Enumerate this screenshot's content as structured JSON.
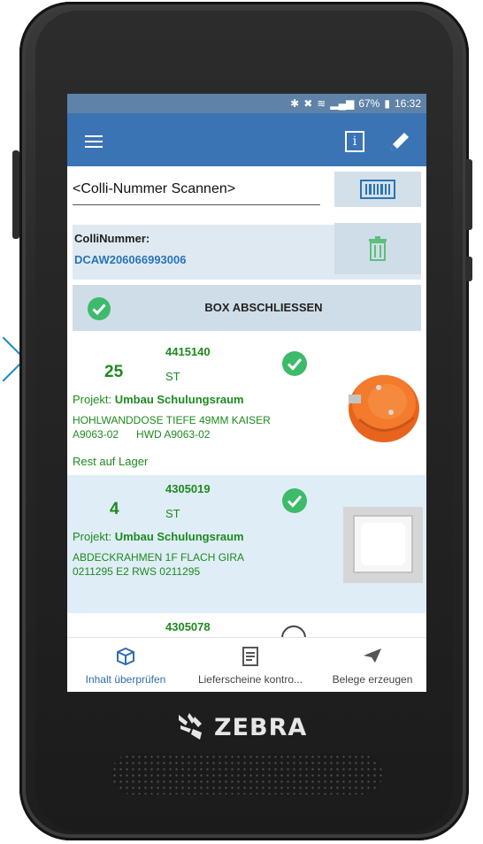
{
  "status_bar": {
    "icons": [
      "bluetooth-icon",
      "nfc-icon",
      "wifi-icon",
      "signal-icon",
      "battery-icon"
    ],
    "battery": "67%",
    "time": "16:32"
  },
  "app_bar": {
    "menu_icon": "hamburger-menu-icon",
    "info_icon": "info-icon",
    "edit_icon": "pencil-icon",
    "color": "#3a74b4"
  },
  "scan": {
    "placeholder": "<Colli-Nummer Scannen>",
    "button_icon": "barcode-icon"
  },
  "colli": {
    "label": "ColliNummer:",
    "value": "DCAW206066993006",
    "delete_icon": "trash-icon"
  },
  "box_close": {
    "label": "BOX ABSCHLIESSEN",
    "icon": "check-circle-icon"
  },
  "items": [
    {
      "article_no": "4415140",
      "quantity": "25",
      "unit": "ST",
      "project_label": "Projekt:",
      "project_name": "Umbau Schulungsraum",
      "description_line1": "HOHLWANDDOSE TIEFE 49MM KAISER",
      "description_line2": "A9063-02      HWD A9063-02",
      "extra": "Rest auf Lager",
      "status": "checked",
      "image_icon": "orange-junction-box-image"
    },
    {
      "article_no": "4305019",
      "quantity": "4",
      "unit": "ST",
      "project_label": "Projekt:",
      "project_name": "Umbau Schulungsraum",
      "description_line1": "ABDECKRAHMEN 1F FLACH GIRA",
      "description_line2": "0211295 E2 RWS 0211295",
      "status": "checked",
      "image_icon": "white-cover-frame-image"
    },
    {
      "article_no": "4305078",
      "status": "unchecked"
    }
  ],
  "bottom_nav": [
    {
      "label": "Inhalt überprüfen",
      "icon": "box-icon",
      "active": true
    },
    {
      "label": "Lieferscheine kontro...",
      "icon": "document-icon",
      "active": false
    },
    {
      "label": "Belege erzeugen",
      "icon": "send-icon",
      "active": false
    }
  ],
  "device": {
    "brand": "ZEBRA"
  },
  "colors": {
    "accent_blue": "#3a74b4",
    "green_text": "#1e8a1e",
    "check_green": "#3dbb6a",
    "panel_blue": "#dfe9f1"
  }
}
